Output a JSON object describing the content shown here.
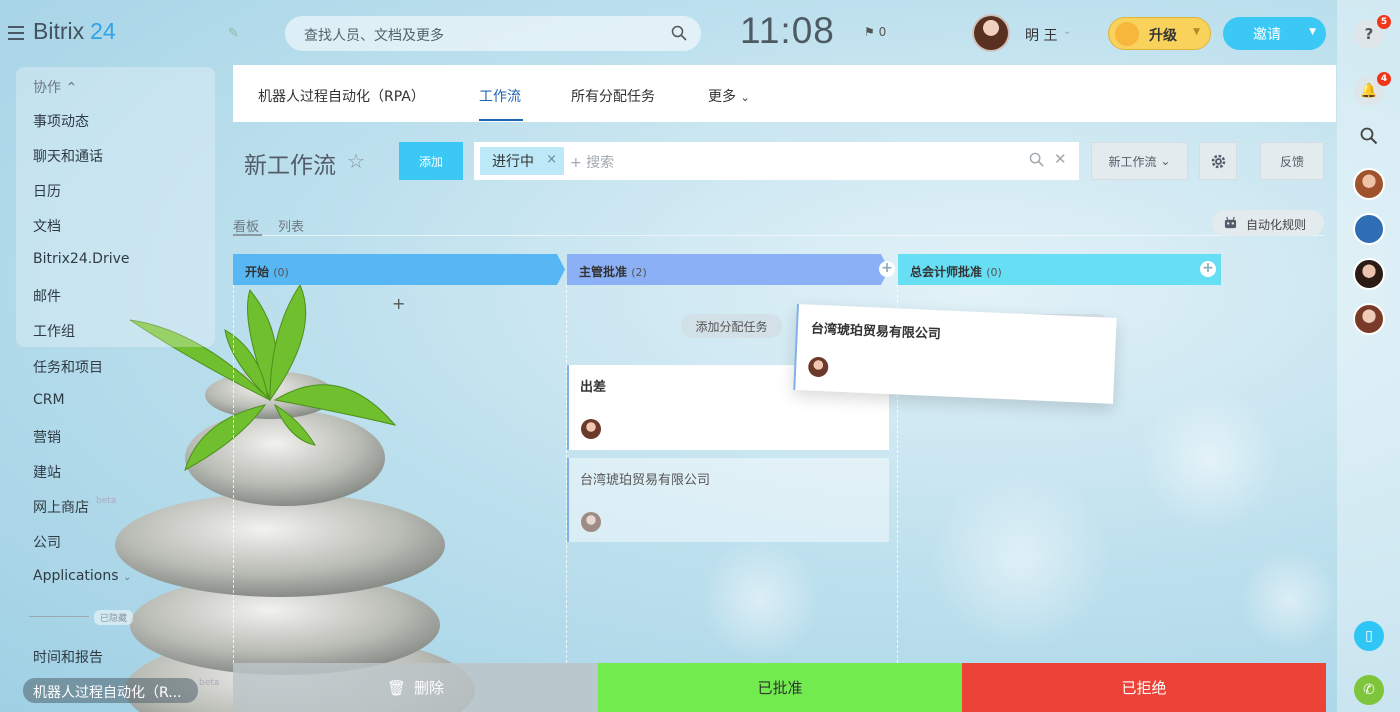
{
  "header": {
    "logo_brand": "Bitrix",
    "logo_num": "24",
    "search_placeholder": "查找人员、文档及更多",
    "clock": "11:08",
    "flag_count": "0",
    "user_name": "明 王",
    "upgrade_label": "升级",
    "invite_label": "邀请"
  },
  "left_menu": {
    "group_label": "协作",
    "items": [
      "事项动态",
      "聊天和通话",
      "日历",
      "文档",
      "Bitrix24.Drive",
      "邮件",
      "工作组",
      "任务和项目",
      "CRM",
      "营销",
      "建站",
      "网上商店",
      "公司",
      "Applications"
    ],
    "beta_label": "beta",
    "hidden_label": "已隐藏",
    "lower_items": [
      "时间和报告",
      "机器人过程自动化（R..."
    ]
  },
  "tabs": [
    "机器人过程自动化（RPA）",
    "工作流",
    "所有分配任务",
    "更多"
  ],
  "page": {
    "title": "新工作流",
    "add_label": "添加",
    "filter_chip": "进行中",
    "filter_placeholder": "+ 搜索",
    "new_workflow_label": "新工作流",
    "feedback_label": "反馈"
  },
  "views": {
    "kanban": "看板",
    "list": "列表",
    "automation_rules": "自动化规则"
  },
  "kanban": {
    "columns": [
      {
        "name": "开始",
        "count": "(0)",
        "color": "#57b7f5"
      },
      {
        "name": "主管批准",
        "count": "(2)",
        "color": "#8cb0f5"
      },
      {
        "name": "总会计师批准",
        "count": "(0)",
        "color": "#66dff5"
      }
    ],
    "add_task_label": "添加分配任务",
    "cards": [
      "出差",
      "台湾琥珀贸易有限公司"
    ],
    "dragging_card": "台湾琥珀贸易有限公司"
  },
  "actions": {
    "delete": "删除",
    "approve": "已批准",
    "reject": "已拒绝"
  },
  "right_bar": {
    "help_badge": "5",
    "notify_badge": "4"
  }
}
